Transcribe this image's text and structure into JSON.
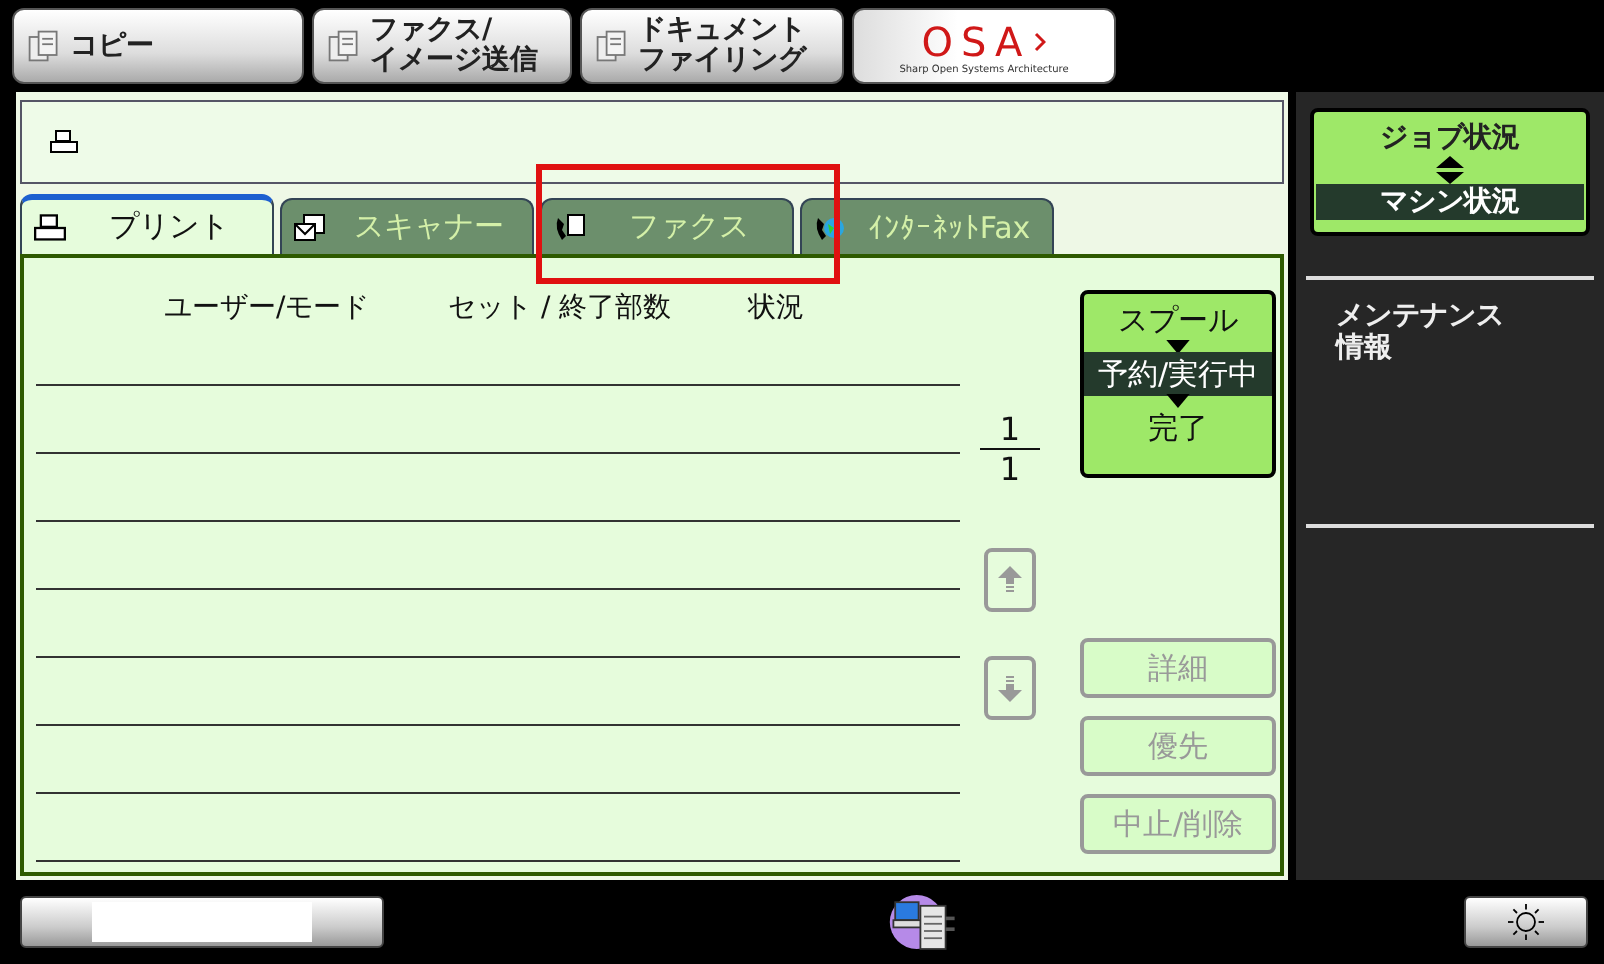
{
  "top_buttons": [
    {
      "kind": "mode",
      "lines": [
        "コピー"
      ]
    },
    {
      "kind": "mode",
      "lines": [
        "ファクス/",
        "イメージ送信"
      ]
    },
    {
      "kind": "mode",
      "lines": [
        "ドキュメント",
        "ファイリング"
      ]
    },
    {
      "kind": "logo",
      "lines": [
        "OSA"
      ],
      "tagline": "Sharp Open Systems Architecture"
    }
  ],
  "tabs": [
    {
      "label": "プリント",
      "kind": "print",
      "selected": true,
      "highlighted": false
    },
    {
      "label": "スキャナー",
      "kind": "scanner",
      "selected": false,
      "highlighted": false
    },
    {
      "label": "ファクス",
      "kind": "fax",
      "selected": false,
      "highlighted": true
    },
    {
      "label": "ｲﾝﾀｰﾈｯﾄFax",
      "kind": "internet-fax",
      "selected": false,
      "highlighted": false
    }
  ],
  "table": {
    "columns": [
      "ユーザー/モード",
      "セット / 終了部数",
      "状況"
    ]
  },
  "pager": {
    "current": "1",
    "total": "1"
  },
  "queue_selector": [
    {
      "label": "スプール",
      "selected": false
    },
    {
      "label": "予約/実行中",
      "selected": true
    },
    {
      "label": "完了",
      "selected": false
    }
  ],
  "actions": [
    {
      "label": "詳細",
      "disabled": true
    },
    {
      "label": "優先",
      "disabled": true
    },
    {
      "label": "中止/削除",
      "disabled": true
    }
  ],
  "status_toggle": [
    {
      "label": "ジョブ状況",
      "selected": false
    },
    {
      "label": "マシン状況",
      "selected": true
    }
  ],
  "side_items": [
    {
      "lines": [
        "メンテナンス",
        "情報"
      ]
    }
  ]
}
